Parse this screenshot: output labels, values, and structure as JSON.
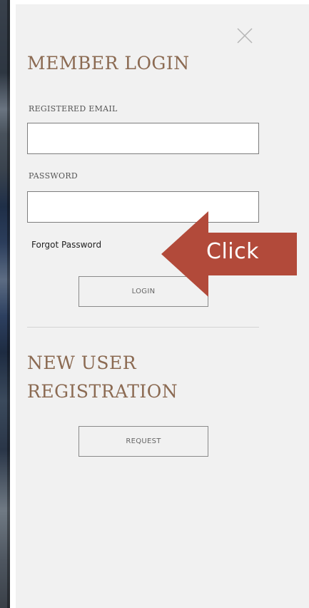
{
  "login_panel": {
    "heading": "MEMBER LOGIN",
    "email_label": "REGISTERED EMAIL",
    "email_value": "",
    "password_label": "PASSWORD",
    "password_value": "",
    "forgot_password": "Forgot Password",
    "login_button": "LOGIN",
    "close_icon": "close-icon"
  },
  "registration": {
    "heading_line1": "NEW USER",
    "heading_line2": "REGISTRATION",
    "request_button": "REQUEST"
  },
  "annotation": {
    "label": "Click",
    "arrow_color": "#b24a3a",
    "icon": "left-arrow-icon"
  },
  "colors": {
    "heading": "#8b6a52",
    "panel_background": "#f1f1f1",
    "input_border": "#7d7d7d"
  }
}
